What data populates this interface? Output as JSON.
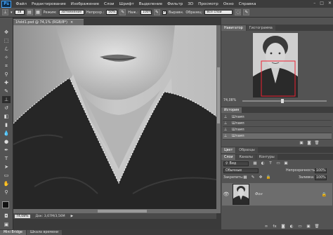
{
  "app": {
    "logo": "Ps"
  },
  "menu": [
    "Файл",
    "Редактирование",
    "Изображение",
    "Слои",
    "Шрифт",
    "Выделение",
    "Фильтр",
    "3D",
    "Просмотр",
    "Окно",
    "Справка"
  ],
  "window_controls": {
    "minimize": "–",
    "maximize": "□",
    "close": "✕"
  },
  "options": {
    "brush_size": "18",
    "mode_label": "Режим:",
    "mode_value": "Затемнение",
    "opacity_label": "Непрозр.:",
    "opacity_value": "50%",
    "pressure_label": "Наж.:",
    "pressure_value": "100%",
    "aligned_label": "Выравн.",
    "sample_label": "Образец:",
    "sample_value": "Все слои"
  },
  "document": {
    "tab_title": "1fold1.psd @ 74,1% (RGB/8*)",
    "close": "×"
  },
  "status": {
    "zoom": "74,08%",
    "doc_size": "Док: 3,67М/3,56М",
    "arrow": "▶"
  },
  "navigator": {
    "tabs": [
      "Навигатор",
      "Гистограмма"
    ],
    "zoom": "74,08%"
  },
  "history": {
    "tab": "История",
    "items": [
      "Штамп",
      "Штамп",
      "Штамп",
      "Штамп"
    ]
  },
  "color_panel": {
    "tabs": [
      "Цвет",
      "Образцы"
    ]
  },
  "layers_panel": {
    "tabs": [
      "Слои",
      "Каналы",
      "Контуры"
    ],
    "filter_label": "Вид",
    "blend_mode": "Обычные",
    "opacity_label": "Непрозрачность:",
    "opacity_value": "100%",
    "lock_label": "Закрепить:",
    "fill_label": "Заливка:",
    "fill_value": "100%",
    "layer_name": "Фон"
  },
  "bottom_tabs": [
    "Mini Bridge",
    "Шкала времени"
  ],
  "colors": {
    "bg_dark": "#3c3c3c",
    "panel": "#535353",
    "accent": "#41a5ff"
  }
}
